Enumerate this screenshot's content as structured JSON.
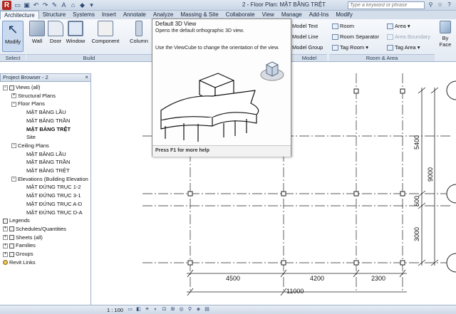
{
  "app": {
    "logo": "R",
    "document_title": "2 - Floor Plan: MẶT BẰNG TRỆT",
    "search_placeholder": "Type a keyword or phrase"
  },
  "ribbon_tabs": [
    "Architecture",
    "Structure",
    "Systems",
    "Insert",
    "Annotate",
    "Analyze",
    "Massing & Site",
    "Collaborate",
    "View",
    "Manage",
    "Add-Ins",
    "Modify"
  ],
  "ribbon": {
    "tools": [
      "Modify",
      "Wall",
      "Door",
      "Window",
      "Component",
      "Column"
    ],
    "groups": [
      "Select",
      "Build",
      "Model",
      "Room & Area"
    ],
    "model": [
      "Model Text",
      "Model Line",
      "Model Group"
    ],
    "room": [
      "Room",
      "Room Separator",
      "Tag Room"
    ],
    "area": [
      "Area",
      "Area Boundary",
      "Tag Area"
    ],
    "right_tools": [
      "By Face"
    ]
  },
  "tooltip": {
    "title": "Default 3D View",
    "description": "Opens the default orthographic 3D view.",
    "viewcube_hint": "Use the ViewCube to change the orientation of the view.",
    "footer": "Press F1 for more help"
  },
  "project_browser": {
    "title": "Project Browser - 2",
    "close": "×",
    "nodes": [
      {
        "label": "Views (all)",
        "depth": 0,
        "expander": "−",
        "bold": false,
        "icon": "views-icon"
      },
      {
        "label": "Structural Plans",
        "depth": 1,
        "expander": "+",
        "bold": false
      },
      {
        "label": "Floor Plans",
        "depth": 1,
        "expander": "−",
        "bold": false
      },
      {
        "label": "MẶT BẰNG LẦU",
        "depth": 2,
        "expander": "",
        "bold": false
      },
      {
        "label": "MẶT BẰNG TRẦN",
        "depth": 2,
        "expander": "",
        "bold": false
      },
      {
        "label": "MẶT BẰNG TRỆT",
        "depth": 2,
        "expander": "",
        "bold": true
      },
      {
        "label": "Site",
        "depth": 2,
        "expander": "",
        "bold": false
      },
      {
        "label": "Ceiling Plans",
        "depth": 1,
        "expander": "−",
        "bold": false
      },
      {
        "label": "MẶT BẰNG LẦU",
        "depth": 2,
        "expander": "",
        "bold": false
      },
      {
        "label": "MẶT BẰNG TRẦN",
        "depth": 2,
        "expander": "",
        "bold": false
      },
      {
        "label": "MẶT BẰNG TRỆT",
        "depth": 2,
        "expander": "",
        "bold": false
      },
      {
        "label": "Elevations (Building Elevation",
        "depth": 1,
        "expander": "−",
        "bold": false
      },
      {
        "label": "MẶT ĐỨNG TRỤC 1-2",
        "depth": 2,
        "expander": "",
        "bold": false
      },
      {
        "label": "MẶT ĐỨNG TRỤC 3-1",
        "depth": 2,
        "expander": "",
        "bold": false
      },
      {
        "label": "MẶT ĐỨNG TRỤC A-D",
        "depth": 2,
        "expander": "",
        "bold": false
      },
      {
        "label": "MẶT ĐỨNG TRỤC D-A",
        "depth": 2,
        "expander": "",
        "bold": false
      },
      {
        "label": "Legends",
        "depth": 0,
        "expander": "",
        "bold": false,
        "icon": "legends-icon"
      },
      {
        "label": "Schedules/Quantities",
        "depth": 0,
        "expander": "+",
        "bold": false,
        "icon": "schedules-icon"
      },
      {
        "label": "Sheets (all)",
        "depth": 0,
        "expander": "+",
        "bold": false,
        "icon": "sheets-icon"
      },
      {
        "label": "Families",
        "depth": 0,
        "expander": "+",
        "bold": false,
        "icon": "families-icon"
      },
      {
        "label": "Groups",
        "depth": 0,
        "expander": "+",
        "bold": false,
        "icon": "groups-icon"
      },
      {
        "label": "Revit Links",
        "depth": 0,
        "expander": "",
        "bold": false,
        "icon": "revit-links-icon"
      }
    ]
  },
  "drawing": {
    "dimensions_horizontal": [
      "4500",
      "4200",
      "2300"
    ],
    "dimension_total": "11000",
    "dimensions_vertical": [
      "5400",
      "600",
      "3000"
    ],
    "dimension_vertical_total": "9000"
  },
  "status_bar": {
    "scale": "1 : 100"
  },
  "colors": {
    "ribbon_bg": "#e3eaf3",
    "title_bg": "#c9d6e6",
    "accent": "#b3261e"
  }
}
